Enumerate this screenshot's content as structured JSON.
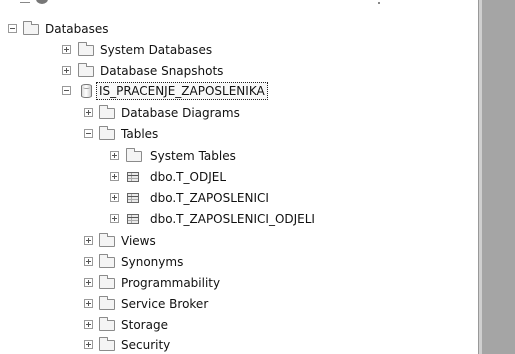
{
  "tree": {
    "databases": "Databases",
    "system_databases": "System Databases",
    "database_snapshots": "Database Snapshots",
    "selected_db": "IS_PRACENJE_ZAPOSLENIKA",
    "database_diagrams": "Database Diagrams",
    "tables": "Tables",
    "system_tables": "System Tables",
    "table_1": "dbo.T_ODJEL",
    "table_2": "dbo.T_ZAPOSLENICI",
    "table_3": "dbo.T_ZAPOSLENICI_ODJELI",
    "views": "Views",
    "synonyms": "Synonyms",
    "programmability": "Programmability",
    "service_broker": "Service Broker",
    "storage": "Storage",
    "security": "Security"
  },
  "colors": {
    "side_panel": "#a5a5a5",
    "background": "#ffffff"
  },
  "icons": {
    "folder": "folder-icon",
    "table": "table-icon",
    "database": "database-icon",
    "expand": "expand-plus-icon",
    "collapse": "collapse-minus-icon"
  }
}
